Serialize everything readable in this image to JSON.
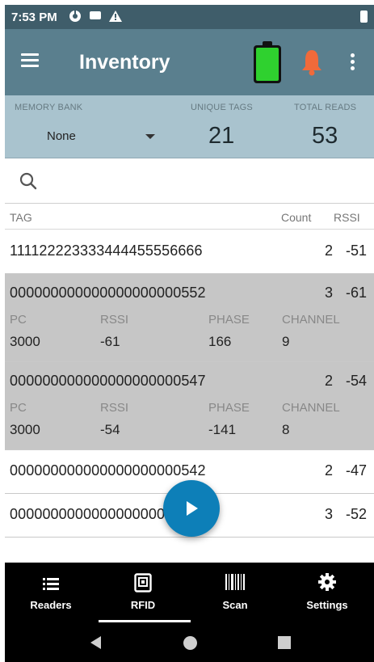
{
  "status_bar": {
    "time": "7:53 PM",
    "icons": [
      "sync-icon",
      "message-icon",
      "warning-icon",
      "battery-icon"
    ]
  },
  "app_bar": {
    "title": "Inventory",
    "battery_color": "#2fd12f",
    "bell_color": "#f06a3a",
    "icons": [
      "menu-icon",
      "reader-battery-icon",
      "bell-icon",
      "overflow-menu-icon"
    ]
  },
  "summary": {
    "memory_bank_label": "MEMORY BANK",
    "memory_bank_value": "None",
    "unique_tags_label": "UNIQUE TAGS",
    "unique_tags_value": "21",
    "total_reads_label": "TOTAL READS",
    "total_reads_value": "53"
  },
  "search": {
    "value": "",
    "placeholder": ""
  },
  "list_header": {
    "tag": "TAG",
    "count": "Count",
    "rssi": "RSSI"
  },
  "detail_labels": {
    "pc": "PC",
    "rssi": "RSSI",
    "phase": "PHASE",
    "channel": "CHANNEL"
  },
  "rows": [
    {
      "tag": "111122223333444455556666",
      "count": "2",
      "rssi": "-51"
    },
    {
      "tag": "000000000000000000000552",
      "count": "3",
      "rssi": "-61",
      "pc": "3000",
      "rssi_detail": "-61",
      "phase": "166",
      "channel": "9"
    },
    {
      "tag": "000000000000000000000547",
      "count": "2",
      "rssi": "-54",
      "pc": "3000",
      "rssi_detail": "-54",
      "phase": "-141",
      "channel": "8"
    },
    {
      "tag": "000000000000000000000542",
      "count": "2",
      "rssi": "-47"
    },
    {
      "tag": "000000000000000000000539",
      "count": "3",
      "rssi": "-52"
    }
  ],
  "bottom_nav": {
    "readers": "Readers",
    "rfid": "RFID",
    "scan": "Scan",
    "settings": "Settings",
    "active": "RFID"
  },
  "colors": {
    "status_bar": "#3f5d6a",
    "app_bar": "#5a7f8e",
    "summary_bg": "#a9c3ce",
    "expanded_row_bg": "#c6c6c6",
    "fab": "#0d7fb8"
  }
}
